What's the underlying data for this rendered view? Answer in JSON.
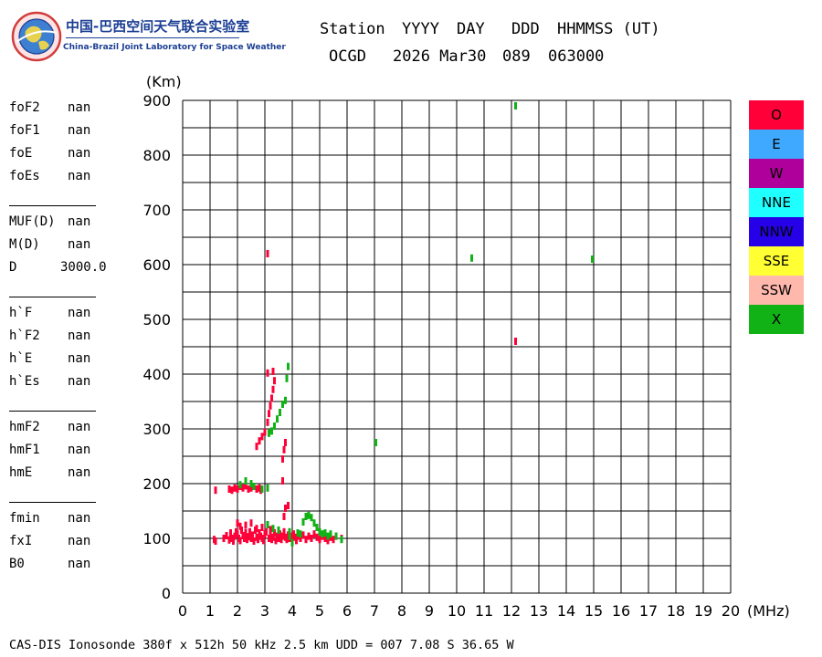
{
  "logo": {
    "title_cn": "中国-巴西空间天气联合实验室",
    "title_en": "China-Brazil Joint Laboratory for Space Weather"
  },
  "header": {
    "labels": [
      "Station",
      "YYYY",
      "DAY",
      "DDD",
      "HHMMSS (UT)"
    ],
    "values": [
      "OCGD",
      "2026 Mar30",
      "089",
      "063000"
    ]
  },
  "params": [
    {
      "label": "foF2",
      "value": "nan"
    },
    {
      "label": "foF1",
      "value": "nan"
    },
    {
      "label": "foE",
      "value": "nan"
    },
    {
      "label": "foEs",
      "value": "nan"
    },
    {
      "label": "MUF(D)",
      "value": "nan"
    },
    {
      "label": "M(D)",
      "value": "nan"
    },
    {
      "label": "D",
      "value": "3000.0"
    },
    {
      "label": "h`F",
      "value": "nan"
    },
    {
      "label": "h`F2",
      "value": "nan"
    },
    {
      "label": "h`E",
      "value": "nan"
    },
    {
      "label": "h`Es",
      "value": "nan"
    },
    {
      "label": "hmF2",
      "value": "nan"
    },
    {
      "label": "hmF1",
      "value": "nan"
    },
    {
      "label": "hmE",
      "value": "nan"
    },
    {
      "label": "fmin",
      "value": "nan"
    },
    {
      "label": "fxI",
      "value": "nan"
    },
    {
      "label": "B0",
      "value": "nan"
    }
  ],
  "legend": [
    {
      "label": "O",
      "color": "#ff0038"
    },
    {
      "label": "E",
      "color": "#3fa9ff"
    },
    {
      "label": "W",
      "color": "#b0009b"
    },
    {
      "label": "NNE",
      "color": "#20ffff"
    },
    {
      "label": "NNW",
      "color": "#2600e6"
    },
    {
      "label": "SSE",
      "color": "#ffff33"
    },
    {
      "label": "SSW",
      "color": "#ffb8ac"
    },
    {
      "label": "X",
      "color": "#11b216"
    }
  ],
  "footer": "CAS-DIS Ionosonde 380f x 512h 50 kHz 2.5 km UDD = 007 7.08 S 36.65 W",
  "chart_data": {
    "type": "scatter",
    "title": "",
    "xlabel": "(MHz)",
    "ylabel": "(Km)",
    "xlim": [
      0,
      20
    ],
    "ylim": [
      0,
      900
    ],
    "xticks": [
      "0",
      "1",
      "2",
      "3",
      "4",
      "5",
      "6",
      "7",
      "8",
      "9",
      "10",
      "11",
      "12",
      "13",
      "14",
      "15",
      "16",
      "17",
      "18",
      "19",
      "20"
    ],
    "yticks": [
      "0",
      "100",
      "200",
      "300",
      "400",
      "500",
      "600",
      "700",
      "800",
      "900"
    ],
    "grid": true,
    "legend_position": "right",
    "series": [
      {
        "name": "O",
        "color": "#ff0038",
        "points": [
          [
            1.15,
            98
          ],
          [
            1.2,
            95
          ],
          [
            1.5,
            100
          ],
          [
            1.6,
            105
          ],
          [
            1.7,
            97
          ],
          [
            1.75,
            110
          ],
          [
            1.8,
            100
          ],
          [
            1.85,
            95
          ],
          [
            1.9,
            104
          ],
          [
            1.95,
            112
          ],
          [
            2.0,
            108
          ],
          [
            2.05,
            100
          ],
          [
            2.1,
            96
          ],
          [
            2.15,
            115
          ],
          [
            2.2,
            105
          ],
          [
            2.25,
            100
          ],
          [
            2.3,
            110
          ],
          [
            2.35,
            98
          ],
          [
            2.4,
            103
          ],
          [
            2.45,
            112
          ],
          [
            2.5,
            100
          ],
          [
            2.55,
            106
          ],
          [
            2.6,
            95
          ],
          [
            2.65,
            115
          ],
          [
            2.7,
            102
          ],
          [
            2.75,
            98
          ],
          [
            2.8,
            110
          ],
          [
            2.85,
            104
          ],
          [
            2.9,
            100
          ],
          [
            2.95,
            96
          ],
          [
            3.0,
            108
          ],
          [
            3.05,
            112
          ],
          [
            3.15,
            100
          ],
          [
            3.2,
            105
          ],
          [
            3.25,
            98
          ],
          [
            3.3,
            102
          ],
          [
            3.35,
            110
          ],
          [
            3.4,
            96
          ],
          [
            3.45,
            104
          ],
          [
            3.5,
            100
          ],
          [
            3.55,
            108
          ],
          [
            3.6,
            98
          ],
          [
            3.65,
            104
          ],
          [
            3.7,
            112
          ],
          [
            3.75,
            102
          ],
          [
            3.8,
            98
          ],
          [
            3.85,
            106
          ],
          [
            3.9,
            100
          ],
          [
            3.95,
            104
          ],
          [
            4.0,
            98
          ],
          [
            4.05,
            108
          ],
          [
            4.1,
            102
          ],
          [
            4.15,
            96
          ],
          [
            4.2,
            104
          ],
          [
            4.3,
            100
          ],
          [
            4.4,
            106
          ],
          [
            4.5,
            98
          ],
          [
            4.6,
            104
          ],
          [
            4.7,
            100
          ],
          [
            4.8,
            108
          ],
          [
            4.9,
            102
          ],
          [
            5.0,
            98
          ],
          [
            5.1,
            104
          ],
          [
            5.2,
            100
          ],
          [
            5.3,
            96
          ],
          [
            5.4,
            102
          ],
          [
            5.5,
            98
          ],
          [
            5.6,
            104
          ],
          [
            5.8,
            100
          ],
          [
            2.0,
            128
          ],
          [
            2.1,
            122
          ],
          [
            2.3,
            124
          ],
          [
            2.5,
            128
          ],
          [
            2.7,
            118
          ],
          [
            2.9,
            120
          ],
          [
            3.2,
            116
          ],
          [
            3.5,
            112
          ],
          [
            3.7,
            140
          ],
          [
            3.75,
            155
          ],
          [
            3.85,
            160
          ],
          [
            1.2,
            188
          ],
          [
            1.7,
            190
          ],
          [
            1.8,
            188
          ],
          [
            1.9,
            192
          ],
          [
            2.0,
            190
          ],
          [
            2.1,
            195
          ],
          [
            2.2,
            192
          ],
          [
            2.3,
            196
          ],
          [
            2.4,
            190
          ],
          [
            2.5,
            192
          ],
          [
            2.6,
            195
          ],
          [
            2.7,
            190
          ],
          [
            2.8,
            192
          ],
          [
            2.85,
            188
          ],
          [
            2.7,
            268
          ],
          [
            2.8,
            278
          ],
          [
            2.9,
            286
          ],
          [
            3.0,
            294
          ],
          [
            3.1,
            312
          ],
          [
            3.15,
            328
          ],
          [
            3.2,
            342
          ],
          [
            3.25,
            356
          ],
          [
            3.3,
            372
          ],
          [
            3.35,
            388
          ],
          [
            3.1,
            402
          ],
          [
            3.3,
            405
          ],
          [
            3.65,
            205
          ],
          [
            3.65,
            245
          ],
          [
            3.7,
            262
          ],
          [
            3.75,
            275
          ],
          [
            3.1,
            620
          ],
          [
            12.15,
            460
          ]
        ]
      },
      {
        "name": "X",
        "color": "#11b216",
        "points": [
          [
            2.1,
            198
          ],
          [
            2.3,
            205
          ],
          [
            2.5,
            200
          ],
          [
            2.6,
            195
          ],
          [
            2.9,
            190
          ],
          [
            3.1,
            192
          ],
          [
            3.1,
            125
          ],
          [
            3.3,
            118
          ],
          [
            3.5,
            115
          ],
          [
            3.9,
            112
          ],
          [
            4.0,
            92
          ],
          [
            4.4,
            130
          ],
          [
            4.5,
            140
          ],
          [
            4.6,
            142
          ],
          [
            4.7,
            138
          ],
          [
            4.8,
            128
          ],
          [
            4.9,
            120
          ],
          [
            5.0,
            112
          ],
          [
            5.1,
            108
          ],
          [
            5.2,
            110
          ],
          [
            5.3,
            104
          ],
          [
            5.4,
            108
          ],
          [
            5.6,
            104
          ],
          [
            5.8,
            98
          ],
          [
            3.9,
            104
          ],
          [
            4.2,
            110
          ],
          [
            4.3,
            108
          ],
          [
            3.15,
            292
          ],
          [
            3.25,
            296
          ],
          [
            3.35,
            305
          ],
          [
            3.45,
            318
          ],
          [
            3.55,
            330
          ],
          [
            3.65,
            345
          ],
          [
            3.75,
            352
          ],
          [
            3.8,
            392
          ],
          [
            3.85,
            414
          ],
          [
            7.05,
            275
          ],
          [
            10.55,
            612
          ],
          [
            14.95,
            610
          ],
          [
            12.15,
            890
          ]
        ]
      }
    ]
  }
}
